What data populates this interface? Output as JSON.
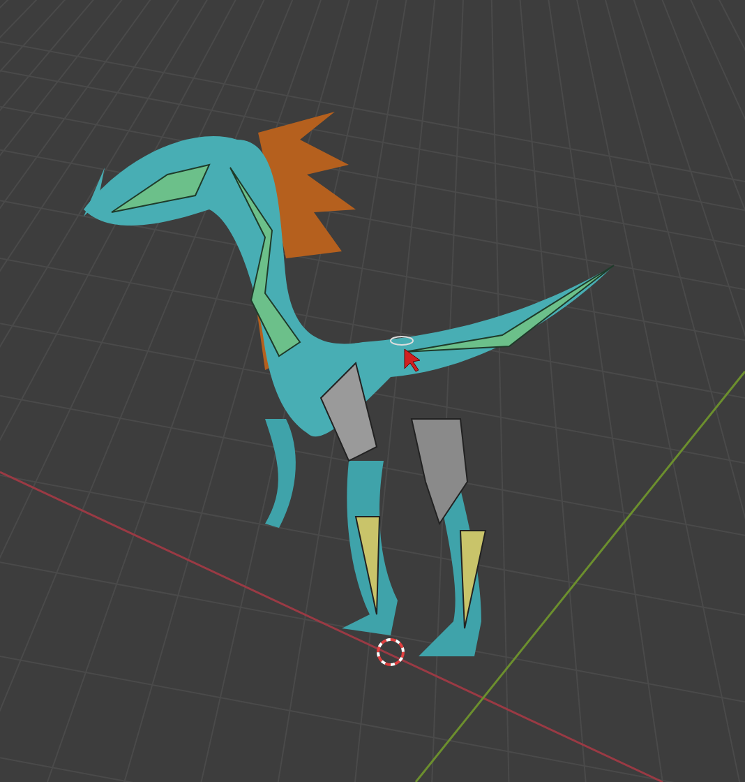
{
  "viewport": {
    "floor_grid": true,
    "axis_lines": true,
    "cursor_3d": true
  }
}
